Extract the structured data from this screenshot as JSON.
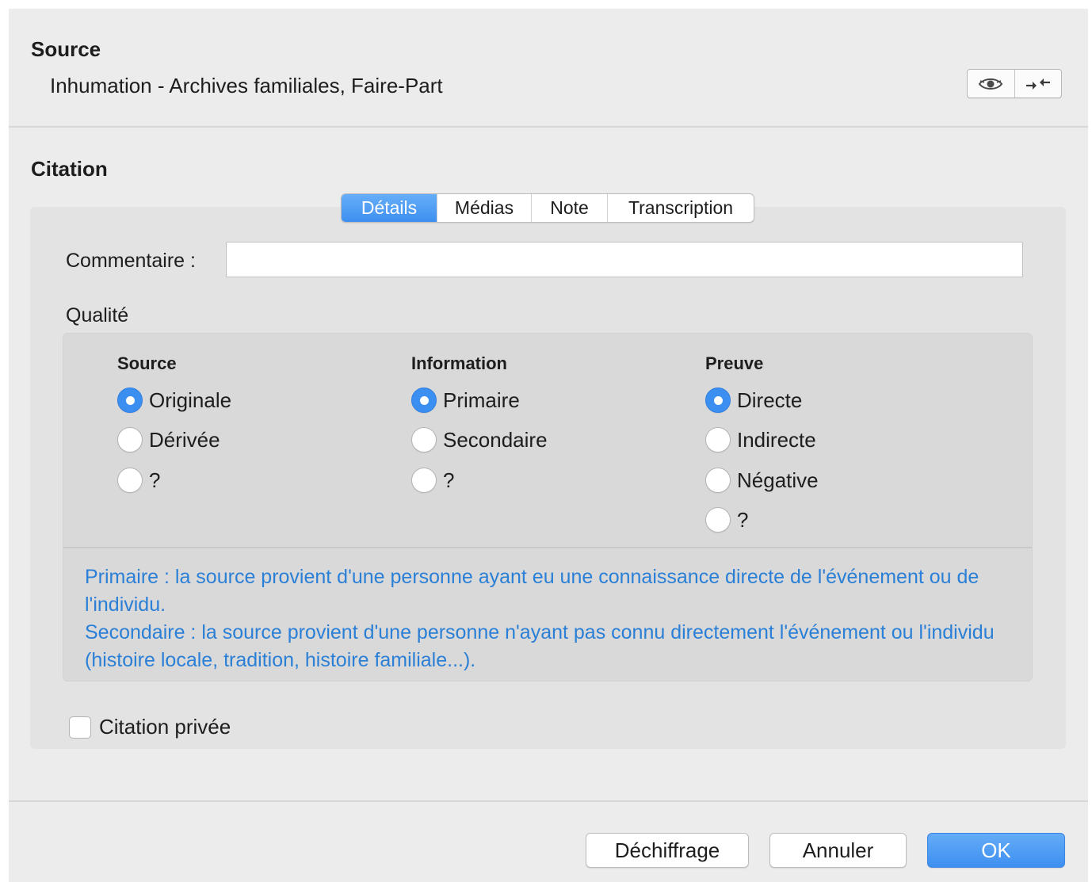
{
  "source": {
    "title": "Source",
    "value": "Inhumation - Archives familiales, Faire-Part",
    "buttons": [
      {
        "icon": "eye-icon",
        "glyph": "👁"
      },
      {
        "icon": "swap-arrows-icon",
        "glyph": "→←"
      }
    ]
  },
  "citation": {
    "title": "Citation",
    "tabs": [
      {
        "label": "Détails",
        "active": true
      },
      {
        "label": "Médias",
        "active": false
      },
      {
        "label": "Note",
        "active": false
      },
      {
        "label": "Transcription",
        "active": false
      }
    ],
    "comment_label": "Commentaire :",
    "comment_value": "",
    "quality_label": "Qualité",
    "columns": [
      {
        "header": "Source",
        "options": [
          "Originale",
          "Dérivée",
          "?"
        ],
        "selected": 0
      },
      {
        "header": "Information",
        "options": [
          "Primaire",
          "Secondaire",
          "?"
        ],
        "selected": 0
      },
      {
        "header": "Preuve",
        "options": [
          "Directe",
          "Indirecte",
          "Négative",
          "?"
        ],
        "selected": 0
      }
    ],
    "help_lines": [
      "Primaire : la source provient d'une personne ayant eu une connaissance directe de l'événement ou de l'individu.",
      "Secondaire : la source provient d'une personne n'ayant pas connu directement l'événement ou l'individu (histoire locale, tradition, histoire familiale...)."
    ],
    "private_label": "Citation privée",
    "private_checked": false
  },
  "footer": {
    "decipher_label": "Déchiffrage",
    "cancel_label": "Annuler",
    "ok_label": "OK"
  },
  "colors": {
    "accent": "#3b8ff0",
    "help_text": "#2a7fd6",
    "window_bg": "#ececec"
  }
}
